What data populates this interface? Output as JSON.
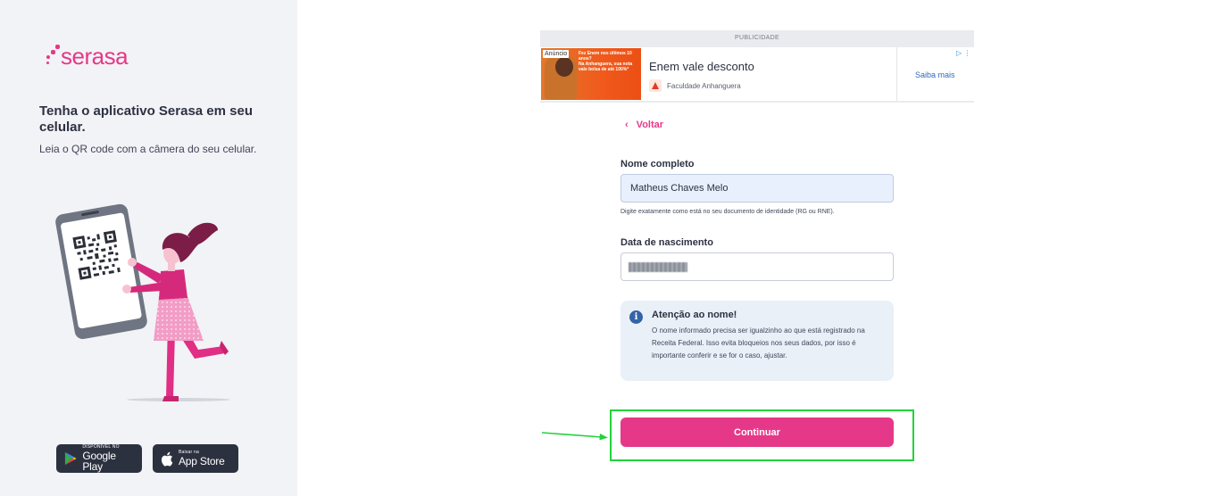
{
  "brand": {
    "name": "serasa",
    "accent": "#e63888"
  },
  "sidebar": {
    "title": "Tenha o aplicativo Serasa em seu celular.",
    "subtitle": "Leia o QR code com a câmera do seu celular.",
    "google_play": {
      "small": "DISPONÍVEL NO",
      "big": "Google Play"
    },
    "app_store": {
      "small": "Baixar na",
      "big": "App Store"
    }
  },
  "ad": {
    "label": "PUBLICIDADE",
    "tag": "Anúncio",
    "image_text": "Fez Enem nos últimos 10 anos?\nNa Anhanguera, sua nota vale bolsa de até 100%*",
    "title": "Enem vale desconto",
    "advertiser": "Faculdade Anhanguera",
    "cta": "Saiba mais",
    "choice_icon": "ad-choices-icon"
  },
  "form": {
    "back_label": "Voltar",
    "name_label": "Nome completo",
    "name_value": "Matheus Chaves Melo",
    "name_hint": "Digite exatamente como está no seu documento de identidade (RG ou RNE).",
    "birth_label": "Data de nascimento",
    "birth_value_redacted": true,
    "alert": {
      "icon": "info-icon",
      "title": "Atenção ao nome!",
      "text": "O nome informado precisa ser igualzinho ao que está registrado na Receita Federal. Isso evita bloqueios nos seus dados, por isso é importante conferir e se for o caso, ajustar."
    },
    "submit_label": "Continuar"
  },
  "annotation": {
    "highlight_color": "#22d33c",
    "arrow_color": "#22d33c"
  }
}
